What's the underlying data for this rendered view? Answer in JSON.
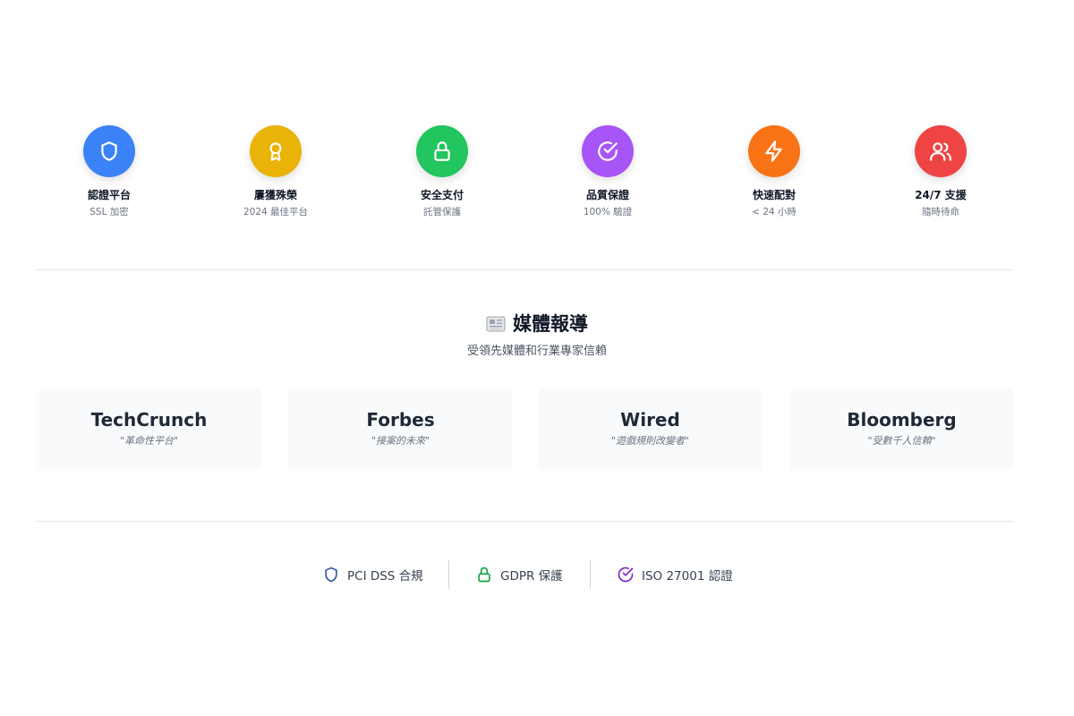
{
  "badges": [
    {
      "title": "認證平台",
      "subtitle": "SSL 加密",
      "icon": "shield-icon",
      "color": "#3b82f6"
    },
    {
      "title": "屢獲殊榮",
      "subtitle": "2024 最佳平台",
      "icon": "award-icon",
      "color": "#eab308"
    },
    {
      "title": "安全支付",
      "subtitle": "託管保護",
      "icon": "lock-icon",
      "color": "#22c55e"
    },
    {
      "title": "品質保證",
      "subtitle": "100% 驗證",
      "icon": "check-circle-icon",
      "color": "#a855f7"
    },
    {
      "title": "快速配對",
      "subtitle": "< 24 小時",
      "icon": "lightning-icon",
      "color": "#f97316"
    },
    {
      "title": "24/7 支援",
      "subtitle": "隨時待命",
      "icon": "users-icon",
      "color": "#ef4444"
    }
  ],
  "media": {
    "heading": "媒體報導",
    "subheading": "受領先媒體和行業專家信賴",
    "outlets": [
      {
        "name": "TechCrunch",
        "quote": "\"革命性平台\""
      },
      {
        "name": "Forbes",
        "quote": "\"接案的未來\""
      },
      {
        "name": "Wired",
        "quote": "\"遊戲規則改變者\""
      },
      {
        "name": "Bloomberg",
        "quote": "\"受數千人信賴\""
      }
    ]
  },
  "compliance": [
    {
      "label": "PCI DSS 合規",
      "icon": "shield-icon",
      "color": "#3b5aa6"
    },
    {
      "label": "GDPR 保護",
      "icon": "lock-icon",
      "color": "#16a34a"
    },
    {
      "label": "ISO 27001 認證",
      "icon": "check-circle-icon",
      "color": "#7e22ce"
    }
  ]
}
